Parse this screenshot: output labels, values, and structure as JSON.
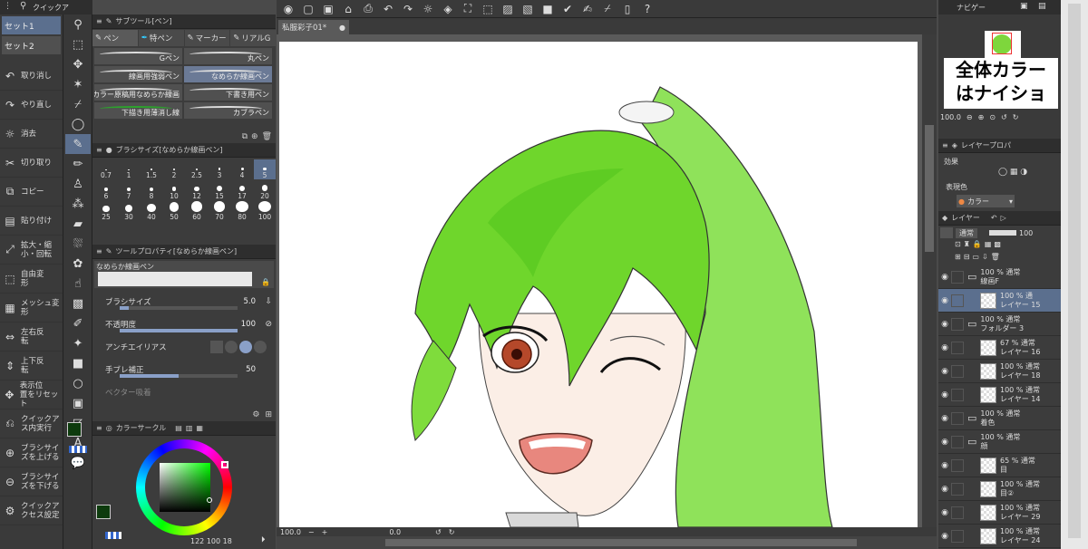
{
  "quick_access": {
    "title": "クイックア",
    "sets": [
      "セット1",
      "セット2"
    ],
    "items": [
      {
        "icon": "undo-icon",
        "label": "取り消し"
      },
      {
        "icon": "redo-icon",
        "label": "やり直し"
      },
      {
        "icon": "erase-icon",
        "label": "消去"
      },
      {
        "icon": "cut-icon",
        "label": "切り取り"
      },
      {
        "icon": "copy-icon",
        "label": "コピー"
      },
      {
        "icon": "paste-icon",
        "label": "貼り付け"
      },
      {
        "icon": "scale-rotate-icon",
        "label": "拡大・縮\n小・回転"
      },
      {
        "icon": "free-transform-icon",
        "label": "自由変\n形"
      },
      {
        "icon": "mesh-transform-icon",
        "label": "メッシュ変\n形"
      },
      {
        "icon": "flip-horizontal-icon",
        "label": "左右反\n転"
      },
      {
        "icon": "flip-vertical-icon",
        "label": "上下反\n転"
      },
      {
        "icon": "reset-view-icon",
        "label": "表示位\n置をリセット"
      },
      {
        "icon": "quick-input-icon",
        "label": "クイックア\nス内実行"
      },
      {
        "icon": "brush-size-up-icon",
        "label": "ブラシサイ\nズを上げる"
      },
      {
        "icon": "brush-size-down-icon",
        "label": "ブラシサイ\nズを下げる"
      },
      {
        "icon": "quick-settings-icon",
        "label": "クイックア\nクセス設定"
      }
    ]
  },
  "subtool": {
    "title": "サブツール[ペン]",
    "tabs": [
      "ペン",
      "特ペン",
      "マーカー",
      "リアルG"
    ],
    "brushes": [
      "Gペン",
      "丸ペン",
      "線画用強弱ペン",
      "なめらか線画ペン",
      "カラー原稿用なめらか線画",
      "下書き用ペン",
      "下描き用薄消し線",
      "カブラペン"
    ]
  },
  "brush_size": {
    "title": "ブラシサイズ[なめらか線画ペン]",
    "sizes": [
      "0.7",
      "1",
      "1.5",
      "2",
      "2.5",
      "3",
      "4",
      "5",
      "6",
      "7",
      "8",
      "10",
      "12",
      "15",
      "17",
      "20",
      "25",
      "30",
      "40",
      "50",
      "60",
      "70",
      "80",
      "100"
    ],
    "selected": "5"
  },
  "tool_property": {
    "title": "ツールプロパティ[なめらか線画ペン]",
    "preset_name": "なめらか線画ペン",
    "brush_size_label": "ブラシサイズ",
    "brush_size_value": "5.0",
    "opacity_label": "不透明度",
    "opacity_value": "100",
    "antialias_label": "アンチエイリアス",
    "stabilization_label": "手ブレ補正",
    "stabilization_value": "50",
    "vector_snap_label": "ベクター吸着"
  },
  "color_circle": {
    "title": "カラーサークル",
    "readout": "122  100  18",
    "main_color": "#0d3b0d"
  },
  "document": {
    "tab_label": "私服彩子01*"
  },
  "status": {
    "zoom": "100.0",
    "angle": "0.0"
  },
  "navigator": {
    "title": "ナビゲー",
    "zoom": "100.0",
    "overlay_text_line1": "全体カラー",
    "overlay_text_line2": "はナイショ"
  },
  "layer_property": {
    "title": "レイヤープロパ",
    "effect_label": "効果",
    "expression_label": "表現色",
    "expression_value": "カラー"
  },
  "layers": {
    "title": "レイヤー",
    "blend_mode": "通常",
    "opacity": "100",
    "rows": [
      {
        "line1": "100 % 通常",
        "line2": "線画F",
        "type": "folder"
      },
      {
        "line1": "100 % 通",
        "line2": "レイヤー 15",
        "type": "layer",
        "selected": true
      },
      {
        "line1": "100 % 通常",
        "line2": "フォルダー 3",
        "type": "folder"
      },
      {
        "line1": "67 % 通常",
        "line2": "レイヤー 16",
        "type": "layer"
      },
      {
        "line1": "100 % 通常",
        "line2": "レイヤー 18",
        "type": "layer"
      },
      {
        "line1": "100 % 通常",
        "line2": "レイヤー 14",
        "type": "layer"
      },
      {
        "line1": "100 % 通常",
        "line2": "着色",
        "type": "folder"
      },
      {
        "line1": "100 % 通常",
        "line2": "顔",
        "type": "folder"
      },
      {
        "line1": "65 % 通常",
        "line2": "目",
        "type": "layer"
      },
      {
        "line1": "100 % 通常",
        "line2": "目②",
        "type": "layer"
      },
      {
        "line1": "100 % 通常",
        "line2": "レイヤー 29",
        "type": "layer"
      },
      {
        "line1": "100 % 通常",
        "line2": "レイヤー 24",
        "type": "layer"
      }
    ]
  }
}
